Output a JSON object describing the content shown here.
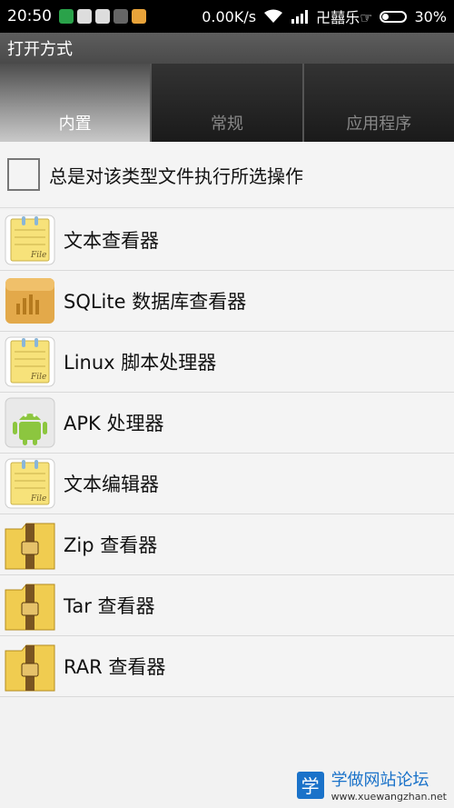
{
  "statusbar": {
    "time": "20:50",
    "network_speed": "0.00K/s",
    "carrier": "卍囍乐☞",
    "battery": "30%"
  },
  "titlebar": {
    "title": "打开方式"
  },
  "tabs": [
    {
      "label": "内置",
      "selected": true
    },
    {
      "label": "常规",
      "selected": false
    },
    {
      "label": "应用程序",
      "selected": false
    }
  ],
  "always_option": {
    "label": "总是对该类型文件执行所选操作",
    "checked": false
  },
  "apps": [
    {
      "label": "文本查看器",
      "icon": "note-file-icon"
    },
    {
      "label": "SQLite 数据库查看器",
      "icon": "database-box-icon"
    },
    {
      "label": "Linux 脚本处理器",
      "icon": "note-file-icon"
    },
    {
      "label": "APK 处理器",
      "icon": "android-icon"
    },
    {
      "label": "文本编辑器",
      "icon": "note-file-icon"
    },
    {
      "label": "Zip 查看器",
      "icon": "zip-folder-icon"
    },
    {
      "label": "Tar 查看器",
      "icon": "zip-folder-icon"
    },
    {
      "label": "RAR 查看器",
      "icon": "zip-folder-icon"
    }
  ],
  "watermark": {
    "logo_char": "学",
    "title": "学做网站论坛",
    "url": "www.xuewangzhan.net"
  }
}
